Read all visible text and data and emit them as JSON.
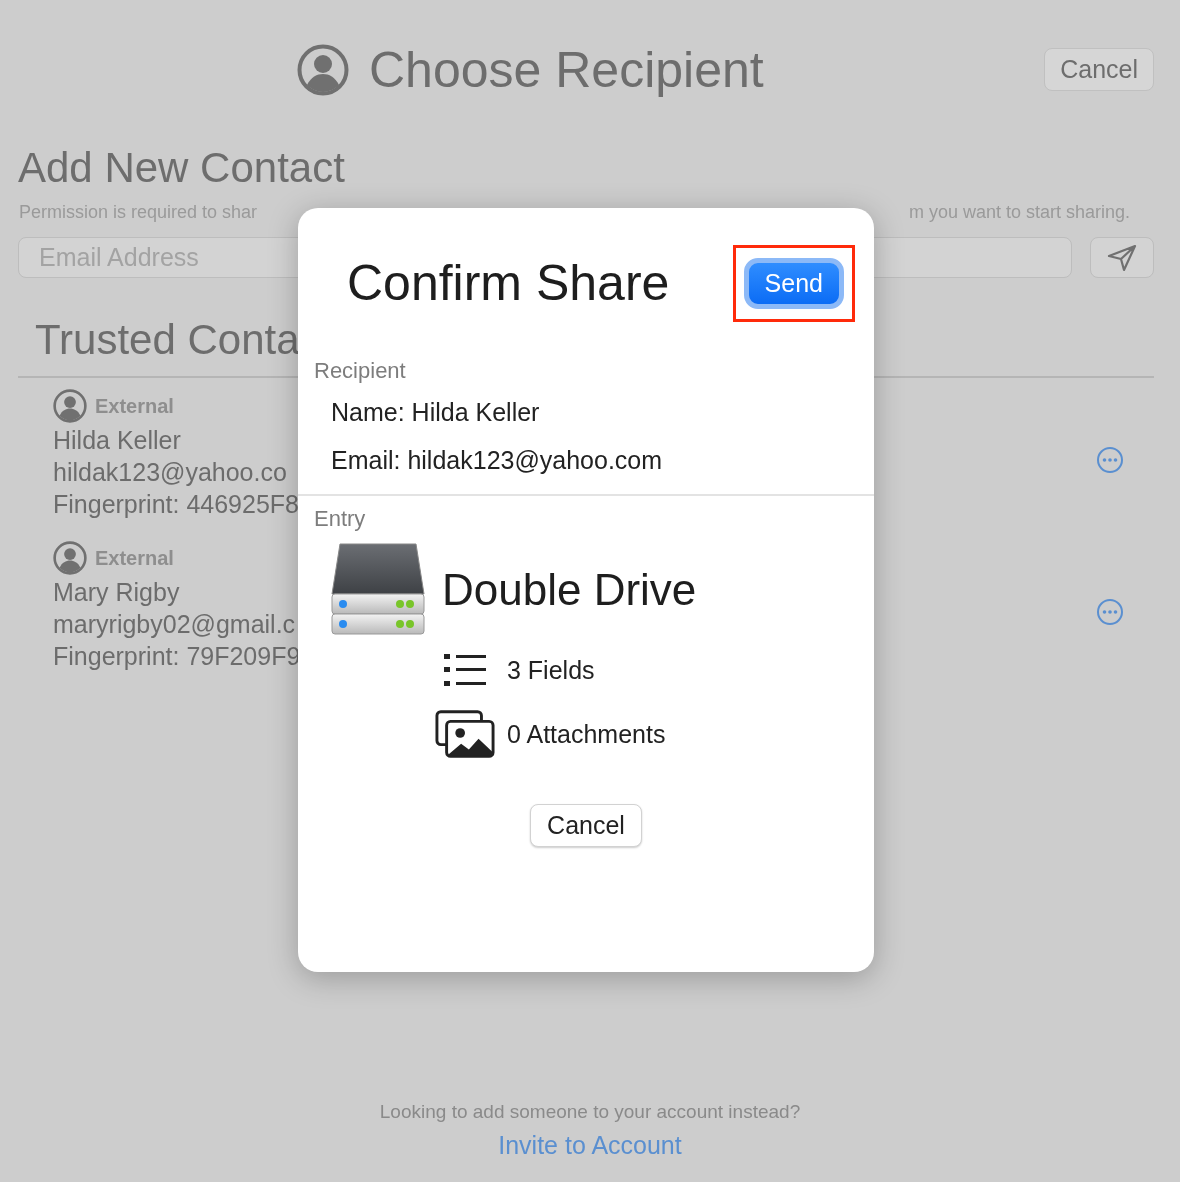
{
  "window": {
    "title": "Choose Recipient",
    "cancel_button": "Cancel"
  },
  "add_contact": {
    "heading": "Add New Contact",
    "description_parts": [
      "Permission is required to shar",
      "m you want to start sharing."
    ],
    "email_field": {
      "placeholder": "Email Address"
    }
  },
  "trusted_contacts": {
    "heading": "Trusted Conta",
    "contacts": [
      {
        "type": "External",
        "name": "Hilda Keller",
        "email": "hildak123@yahoo.co",
        "fingerprint": "Fingerprint: 446925F8"
      },
      {
        "type": "External",
        "name": "Mary Rigby",
        "email": "maryrigby02@gmail.c",
        "fingerprint": "Fingerprint: 79F209F9"
      }
    ]
  },
  "footer": {
    "prompt": "Looking to add someone to your account instead?",
    "link": "Invite to Account"
  },
  "dialog": {
    "title": "Confirm Share",
    "send_button": "Send",
    "send_highlighted": true,
    "recipient": {
      "label": "Recipient",
      "name": "Name: Hilda Keller",
      "email": "Email: hildak123@yahoo.com"
    },
    "entry": {
      "label": "Entry",
      "title": "Double Drive",
      "fields": "3 Fields",
      "attachments": "0 Attachments"
    },
    "cancel_button": "Cancel"
  }
}
